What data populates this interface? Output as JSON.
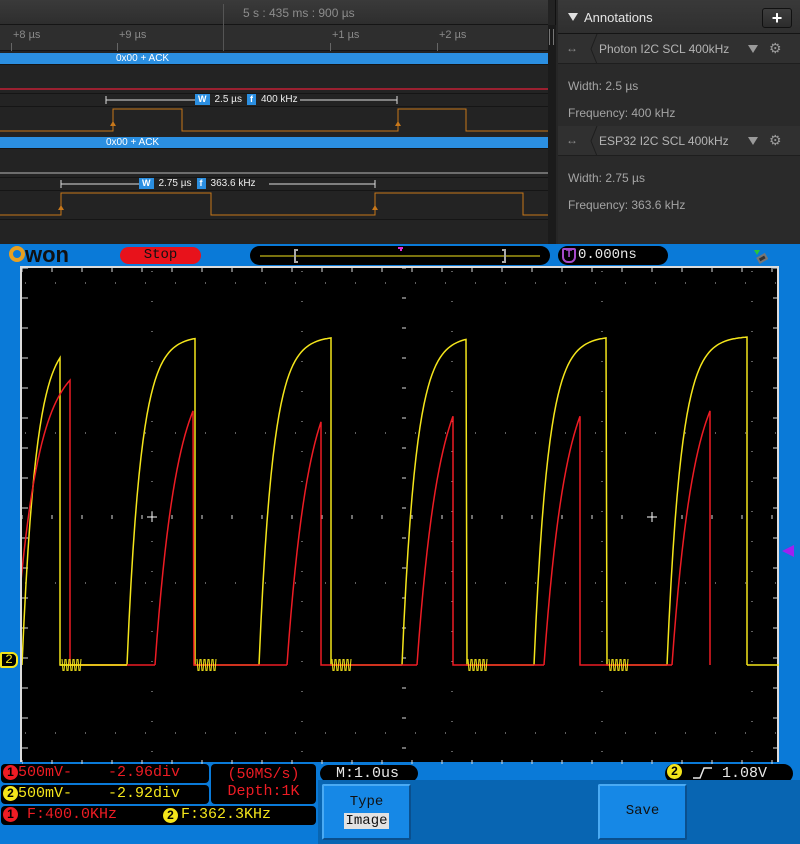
{
  "logic_analyzer": {
    "timestamp": "5 s : 435 ms : 900 µs",
    "ruler_ticks": [
      "+8 µs",
      "+9 µs",
      "+1 µs",
      "+2 µs"
    ],
    "channels": [
      {
        "bus_label": "0x00 + ACK",
        "measurement": {
          "width_label": "W",
          "width": "2.5 µs",
          "freq_label": "f",
          "frequency": "400 kHz"
        }
      },
      {
        "bus_label": "0x00 + ACK",
        "measurement": {
          "width_label": "W",
          "width": "2.75 µs",
          "freq_label": "f",
          "frequency": "363.6 kHz"
        }
      }
    ],
    "colors": {
      "bus": "#2b8fe1",
      "digital_trace": "#c7771a",
      "channel_separator": "#9b2030"
    }
  },
  "annotations_panel": {
    "title": "Annotations",
    "add_button": "+",
    "items": [
      {
        "icon": "↔",
        "name": "Photon I2C SCL 400kHz",
        "width": "Width: 2.5 µs",
        "frequency": "Frequency: 400 kHz"
      },
      {
        "icon": "↔",
        "name": "ESP32 I2C SCL 400kHz",
        "width": "Width: 2.75 µs",
        "frequency": "Frequency: 363.6 kHz"
      }
    ]
  },
  "scope": {
    "brand": "OWON",
    "run_state": "Stop",
    "trigger_icon": "T",
    "trigger_time": "0.000ns",
    "ch2_marker": "2",
    "ch1": {
      "badge": "1",
      "scale": "500mV-",
      "offset": "-2.96div",
      "freq_label": "F:400.0KHz",
      "color": "#ee1c24"
    },
    "ch2": {
      "badge": "2",
      "scale": "500mV-",
      "offset": "-2.92div",
      "freq_label": "F:362.3KHz",
      "color": "#f4e51b"
    },
    "sample_rate": "(50MS/s)",
    "depth": "Depth:1K",
    "timebase": "M:1.0us",
    "trigger": {
      "source": "2",
      "edge": "rising-edge",
      "level": "1.08V"
    },
    "menu": {
      "type_label": "Type",
      "type_value": "Image",
      "save_label": "Save"
    }
  }
}
